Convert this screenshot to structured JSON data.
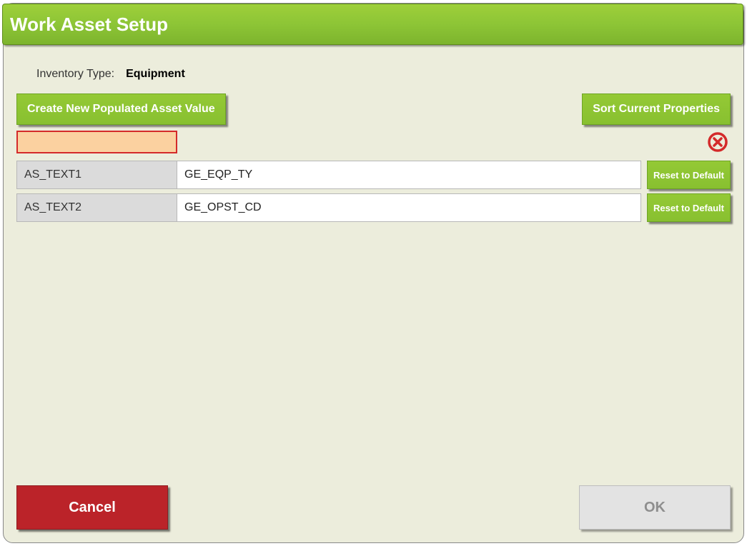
{
  "title": "Work Asset Setup",
  "inventory_type_label": "Inventory Type:",
  "inventory_type_value": "Equipment",
  "toolbar": {
    "create_label": "Create New Populated Asset Value",
    "sort_label": "Sort Current Properties"
  },
  "filter_value": "",
  "rows": [
    {
      "key": "AS_TEXT1",
      "value": "GE_EQP_TY",
      "reset_label": "Reset to Default"
    },
    {
      "key": "AS_TEXT2",
      "value": "GE_OPST_CD",
      "reset_label": "Reset to Default"
    }
  ],
  "footer": {
    "cancel_label": "Cancel",
    "ok_label": "OK"
  }
}
